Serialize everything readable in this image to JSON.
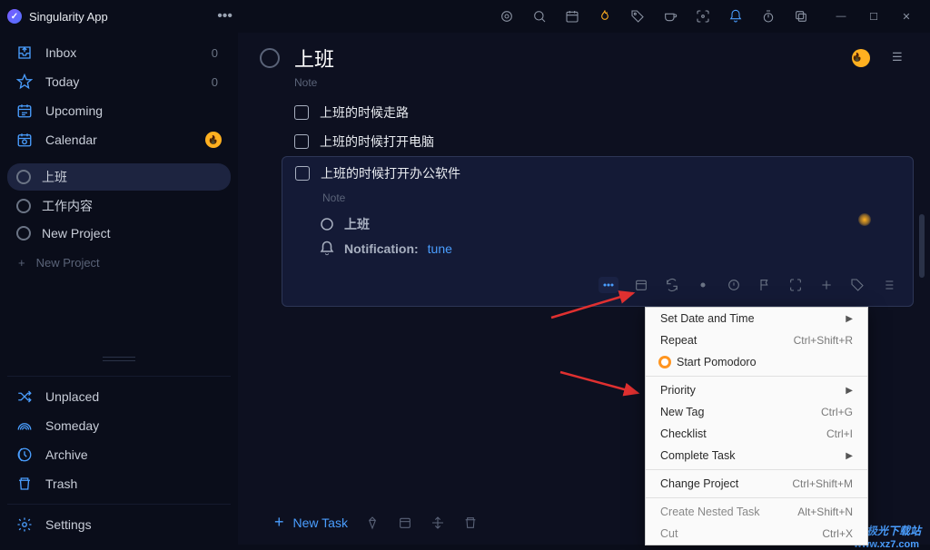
{
  "app": {
    "title": "Singularity App"
  },
  "nav": {
    "inbox": {
      "label": "Inbox",
      "count": "0"
    },
    "today": {
      "label": "Today",
      "count": "0"
    },
    "upcoming": {
      "label": "Upcoming"
    },
    "calendar": {
      "label": "Calendar"
    }
  },
  "projects": [
    {
      "label": "上班",
      "active": true
    },
    {
      "label": "工作内容",
      "active": false
    },
    {
      "label": "New Project",
      "active": false
    }
  ],
  "new_project_label": "New Project",
  "bottom_nav": {
    "unplaced": "Unplaced",
    "someday": "Someday",
    "archive": "Archive",
    "trash": "Trash",
    "settings": "Settings"
  },
  "task": {
    "title": "上班",
    "note_label": "Note",
    "subtasks": [
      {
        "label": "上班的时候走路"
      },
      {
        "label": "上班的时候打开电脑"
      },
      {
        "label": "上班的时候打开办公软件",
        "selected": true
      }
    ],
    "selected_detail": {
      "note_label": "Note",
      "project": "上班",
      "notification_label": "Notification:",
      "notification_value": "tune"
    }
  },
  "context_menu": [
    {
      "label": "Set Date and Time",
      "submenu": true
    },
    {
      "label": "Repeat",
      "shortcut": "Ctrl+Shift+R"
    },
    {
      "label": "Start Pomodoro",
      "icon": "pomodoro"
    },
    {
      "sep": true
    },
    {
      "label": "Priority",
      "submenu": true
    },
    {
      "label": "New Tag",
      "shortcut": "Ctrl+G"
    },
    {
      "label": "Checklist",
      "shortcut": "Ctrl+I"
    },
    {
      "label": "Complete Task",
      "submenu": true
    },
    {
      "sep": true
    },
    {
      "label": "Change Project",
      "shortcut": "Ctrl+Shift+M"
    },
    {
      "sep": true
    },
    {
      "label": "Create Nested Task",
      "shortcut": "Alt+Shift+N"
    },
    {
      "label": "Cut",
      "shortcut": "Ctrl+X"
    }
  ],
  "new_task_label": "New Task",
  "watermark": "极光下载站",
  "watermark_url": "www.xz7.com"
}
